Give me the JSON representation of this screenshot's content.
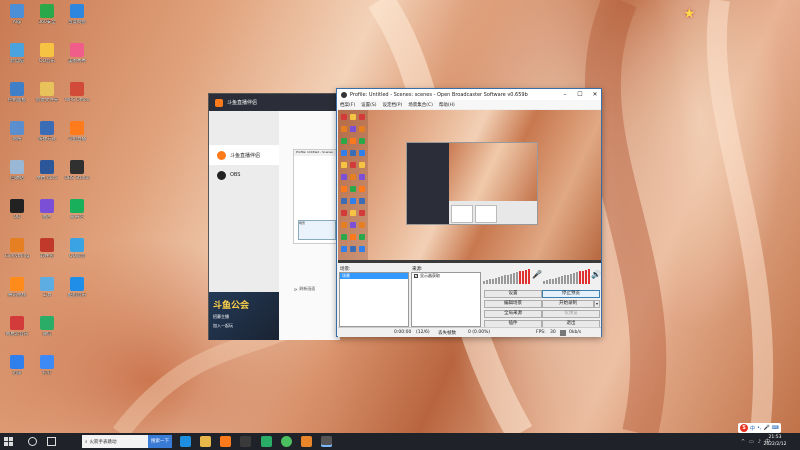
{
  "desktop": {
    "icons": [
      {
        "label": "Algi",
        "color": "#4d8fd6"
      },
      {
        "label": "此电脑",
        "color": "#4aa3df"
      },
      {
        "label": "控制面板",
        "color": "#3f7fc7"
      },
      {
        "label": "网络",
        "color": "#5b8ecf"
      },
      {
        "label": "回收站",
        "color": "#9ab7d6"
      },
      {
        "label": "QQ",
        "color": "#222222"
      },
      {
        "label": "Everything",
        "color": "#e67e22"
      },
      {
        "label": "腾讯视频",
        "color": "#ff8c1a"
      },
      {
        "label": "网易云音乐",
        "color": "#d33b3b"
      },
      {
        "label": "迅雷",
        "color": "#2f80ed"
      },
      {
        "label": "360安全",
        "color": "#2aa84a"
      },
      {
        "label": "QQ音乐",
        "color": "#f6c342"
      },
      {
        "label": "新建文件夹",
        "color": "#e8c25a"
      },
      {
        "label": "快捷方式",
        "color": "#3a6db5"
      },
      {
        "label": "文档.docx",
        "color": "#2b579a"
      },
      {
        "label": "图片",
        "color": "#7b4fd6"
      },
      {
        "label": "软件包",
        "color": "#c0392b"
      },
      {
        "label": "工具",
        "color": "#5dade2"
      },
      {
        "label": "微信",
        "color": "#2aae67"
      },
      {
        "label": "钉钉",
        "color": "#3d8af7"
      },
      {
        "label": "百度网盘",
        "color": "#2e86de"
      },
      {
        "label": "美图秀秀",
        "color": "#f05d8a"
      },
      {
        "label": "WPS Office",
        "color": "#d24b38"
      },
      {
        "label": "斗鱼直播",
        "color": "#ff7a1a"
      },
      {
        "label": "OBS Studio",
        "color": "#303030"
      },
      {
        "label": "爱奇艺",
        "color": "#18b05a"
      },
      {
        "label": "QQ影音",
        "color": "#3aa3e3"
      },
      {
        "label": "酷狗音乐",
        "color": "#1f8ee8"
      }
    ]
  },
  "douyu": {
    "title": "斗鱼直播伴侣",
    "items": [
      {
        "label": "斗鱼直播伴侣",
        "color": "#ff7a1a"
      },
      {
        "label": "OBS",
        "color": "#222222"
      }
    ],
    "banner_big": "斗鱼公会",
    "banner_small": "招募主播",
    "banner_small2": "加入一起玩",
    "preview_title": "Profile: Untitled - Scenes",
    "preview_list_item": "场景",
    "refresh_label": "刷新画面"
  },
  "obs": {
    "title": "Profile: Untitled - Scenes: scenes - Open Broadcaster Software v0.659b",
    "menu": [
      "档案(F)",
      "设置(S)",
      "设定档(P)",
      "场景集合(C)",
      "帮助(H)"
    ],
    "scenes_label": "场景:",
    "scenes": [
      "场景"
    ],
    "sources_label": "来源:",
    "sources": [
      {
        "label": "显示器获取",
        "checked": true
      }
    ],
    "buttons": {
      "settings": "设置",
      "stop_preview": "停止预览",
      "edit_scene": "编辑场景",
      "start_record": "开始录制",
      "global_sources": "全局来源",
      "preview_only": "仅预览",
      "plugins": "插件",
      "exit": "退出"
    },
    "status": {
      "time": "0:00:00",
      "record_time": "(12/6)",
      "dropped": "丢失帧数",
      "dropped_value": "0 (0.00%)",
      "fps_label": "FPS:",
      "fps": "30",
      "bitrate": "0kb/s"
    },
    "meter_color": "#e03030"
  },
  "taskbar": {
    "search_text": "火箭手表跳动",
    "search_button": "搜索一下",
    "tray_lang": "中",
    "time": "21:53",
    "date": "2022/2/12"
  }
}
